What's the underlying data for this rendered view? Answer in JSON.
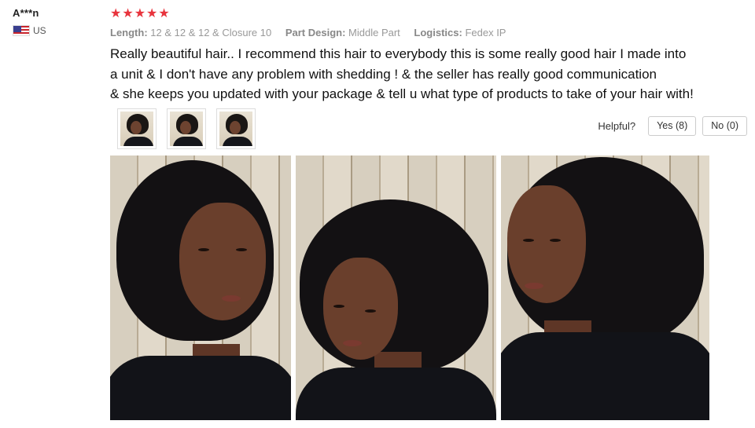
{
  "reviewer": {
    "name": "A***n",
    "country": "US",
    "flag_icon": "us-flag-icon"
  },
  "review": {
    "rating": 5,
    "star_color": "#e8343d",
    "meta": [
      {
        "key": "Length:",
        "value": "12 & 12 & 12 & Closure 10"
      },
      {
        "key": "Part Design:",
        "value": "Middle Part"
      },
      {
        "key": "Logistics:",
        "value": "Fedex IP"
      }
    ],
    "lines": [
      "Really beautiful hair.. I recommend this hair to everybody this is some really good hair I made into",
      "a unit & I don't have any problem with shedding ! & the seller has really good communication",
      "& she keeps you updated with your package & tell u what type of products to take of your hair with!"
    ]
  },
  "thumbnails": [
    "review-photo-1",
    "review-photo-2",
    "review-photo-3"
  ],
  "helpful": {
    "label": "Helpful?",
    "yes": "Yes (8)",
    "no": "No (0)"
  },
  "photos": [
    "review-photo-1",
    "review-photo-2",
    "review-photo-3"
  ]
}
